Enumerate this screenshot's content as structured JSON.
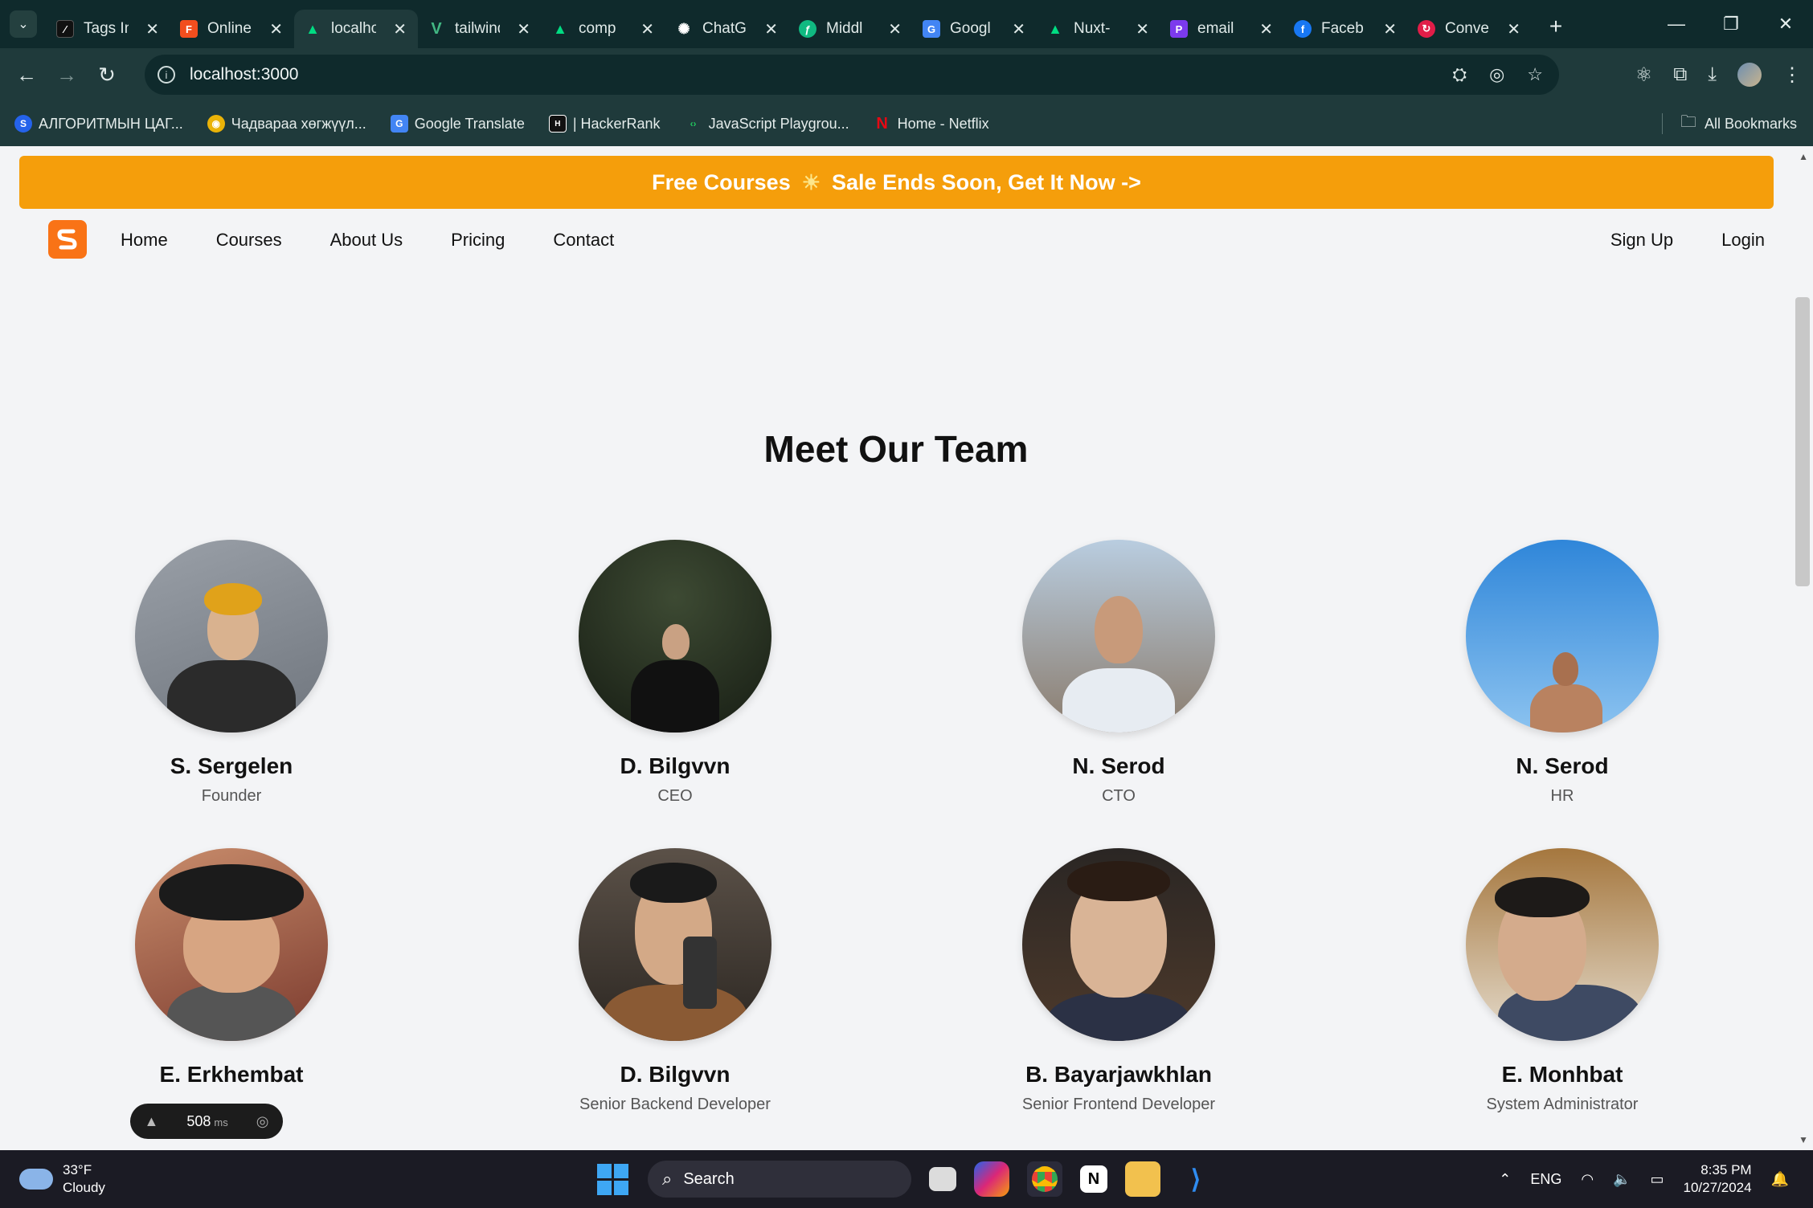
{
  "browser": {
    "tabs": [
      {
        "title": "Tags In",
        "icon": "notion-style-icon",
        "color": "#111111",
        "active": false
      },
      {
        "title": "Online",
        "icon": "figma-icon",
        "color": "#f24e1e",
        "active": false
      },
      {
        "title": "localhost",
        "icon": "nuxt-icon",
        "color": "#00dc82",
        "active": true
      },
      {
        "title": "tailwind",
        "icon": "vue-icon",
        "color": "#42b883",
        "active": false
      },
      {
        "title": "comp",
        "icon": "nuxt-icon",
        "color": "#00dc82",
        "active": false
      },
      {
        "title": "ChatG",
        "icon": "openai-icon",
        "color": "#ffffff",
        "active": false
      },
      {
        "title": "Middl",
        "icon": "feather-icon",
        "color": "#10b981",
        "active": false
      },
      {
        "title": "Googl",
        "icon": "google-translate-icon",
        "color": "#4285f4",
        "active": false
      },
      {
        "title": "Nuxt-",
        "icon": "nuxt-icon",
        "color": "#00dc82",
        "active": false
      },
      {
        "title": "email",
        "icon": "email-icon",
        "color": "#7c3aed",
        "active": false
      },
      {
        "title": "Faceb",
        "icon": "facebook-icon",
        "color": "#1877f2",
        "active": false
      },
      {
        "title": "Conve",
        "icon": "convert-icon",
        "color": "#e11d48",
        "active": false
      }
    ],
    "url": "localhost:3000",
    "bookmarks": [
      {
        "label": "АЛГОРИТМЫН ЦАГ...",
        "icon": "s-logo-icon",
        "color": "#2563eb"
      },
      {
        "label": "Чадвараа хөгжүүл...",
        "icon": "circle-logo-icon",
        "color": "#eab308"
      },
      {
        "label": "Google Translate",
        "icon": "google-translate-icon",
        "color": "#4285f4"
      },
      {
        "label": "| HackerRank",
        "icon": "hackerrank-icon",
        "color": "#111111"
      },
      {
        "label": "JavaScript Playgrou...",
        "icon": "code-icon",
        "color": "#22c55e"
      },
      {
        "label": "Home - Netflix",
        "icon": "netflix-icon",
        "color": "#e50914"
      }
    ],
    "all_bookmarks": "All Bookmarks"
  },
  "banner": {
    "text_left": "Free Courses",
    "text_right": "Sale Ends Soon, Get It Now ->",
    "color": "#f59e0b"
  },
  "nav": {
    "links": [
      "Home",
      "Courses",
      "About Us",
      "Pricing",
      "Contact"
    ],
    "signup": "Sign Up",
    "login": "Login",
    "logo_color": "#f97316"
  },
  "team": {
    "title": "Meet Our Team",
    "members": [
      {
        "name": "S. Sergelen",
        "role": "Founder"
      },
      {
        "name": "D. Bilgvvn",
        "role": "CEO"
      },
      {
        "name": "N. Serod",
        "role": "CTO"
      },
      {
        "name": "N. Serod",
        "role": "HR"
      },
      {
        "name": "E. Erkhembat",
        "role": ""
      },
      {
        "name": "D. Bilgvvn",
        "role": "Senior Backend Developer"
      },
      {
        "name": "B. Bayarjawkhlan",
        "role": "Senior Frontend Developer"
      },
      {
        "name": "E. Monhbat",
        "role": "System Administrator"
      }
    ]
  },
  "devtools": {
    "ms_value": "508",
    "ms_unit": "ms"
  },
  "taskbar": {
    "weather_temp": "33°F",
    "weather_desc": "Cloudy",
    "search_placeholder": "Search",
    "lang": "ENG",
    "time": "8:35 PM",
    "date": "10/27/2024"
  }
}
